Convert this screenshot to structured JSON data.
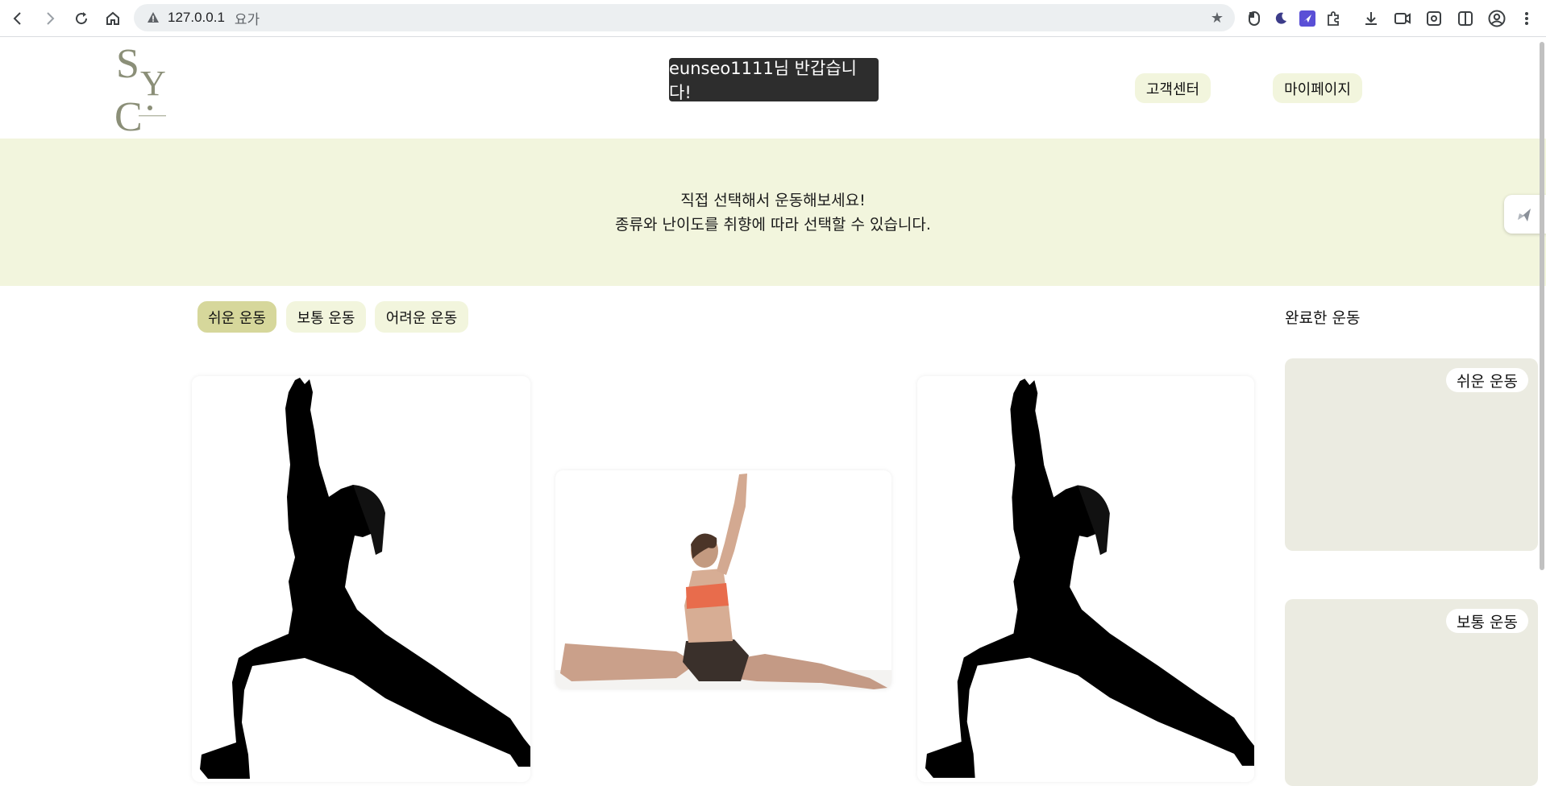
{
  "browser": {
    "url": "127.0.0.1",
    "tab_title": "요가"
  },
  "header": {
    "logo_text": "SYC",
    "greeting": "eunseo1111님 반갑습니다!",
    "customer_center": "고객센터",
    "my_page": "마이페이지"
  },
  "banner": {
    "line1": "직접 선택해서 운동해보세요!",
    "line2": "종류와 난이도를 취향에 따라 선택할 수 있습니다."
  },
  "tabs": [
    {
      "label": "쉬운 운동",
      "active": true
    },
    {
      "label": "보통 운동",
      "active": false
    },
    {
      "label": "어려운 운동",
      "active": false
    }
  ],
  "completed": {
    "title": "완료한 운동",
    "panels": [
      "쉬운 운동",
      "보통 운동"
    ]
  },
  "cards": [
    {
      "icon": "warrior-pose-silhouette"
    },
    {
      "icon": "split-stretch-photo"
    },
    {
      "icon": "warrior-pose-silhouette"
    }
  ],
  "colors": {
    "accent_light": "#f2f5dd",
    "accent_active": "#d6d79b",
    "panel_bg": "#ebebe1",
    "greeting_bg": "#2d2d2d"
  }
}
